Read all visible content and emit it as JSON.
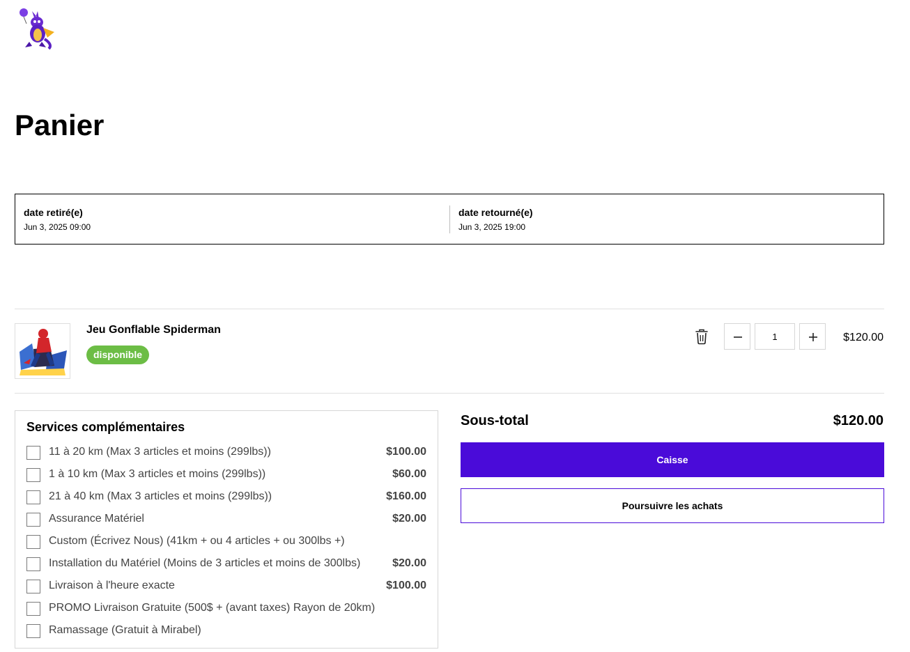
{
  "page": {
    "title": "Panier"
  },
  "dates": {
    "pickup_label": "date retiré(e)",
    "pickup_value": "Jun 3, 2025 09:00",
    "return_label": "date retourné(e)",
    "return_value": "Jun 3, 2025 19:00"
  },
  "cart_item": {
    "name": "Jeu Gonflable Spiderman",
    "status": "disponible",
    "quantity": "1",
    "price": "$120.00"
  },
  "services": {
    "title": "Services complémentaires",
    "items": [
      {
        "label": "11 à 20 km (Max 3 articles et moins (299lbs))",
        "price": "$100.00"
      },
      {
        "label": "1 à 10 km (Max 3 articles et moins (299lbs))",
        "price": "$60.00"
      },
      {
        "label": "21 à 40 km (Max 3 articles et moins (299lbs))",
        "price": "$160.00"
      },
      {
        "label": "Assurance Matériel",
        "price": "$20.00"
      },
      {
        "label": "Custom (Écrivez Nous) (41km + ou 4 articles + ou 300lbs +)",
        "price": ""
      },
      {
        "label": "Installation du Matériel (Moins de 3 articles et moins de 300lbs)",
        "price": "$20.00"
      },
      {
        "label": "Livraison à l'heure exacte",
        "price": "$100.00"
      },
      {
        "label": "PROMO Livraison Gratuite (500$ + (avant taxes) Rayon de 20km)",
        "price": ""
      },
      {
        "label": "Ramassage (Gratuit à Mirabel)",
        "price": ""
      }
    ]
  },
  "summary": {
    "subtotal_label": "Sous-total",
    "subtotal_value": "$120.00",
    "checkout_label": "Caisse",
    "continue_label": "Poursuivre les achats"
  },
  "colors": {
    "accent": "#4a0bd9",
    "badge_available": "#6cbd45"
  },
  "icons": [
    "kangaroo-mascot-logo",
    "trash-icon",
    "minus-icon",
    "plus-icon",
    "checkbox"
  ]
}
